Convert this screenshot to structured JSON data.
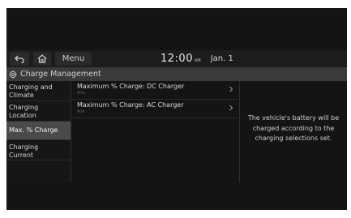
{
  "topbar": {
    "menu_label": "Menu",
    "time": "12:00",
    "ampm": "AM",
    "date": "Jan. 1"
  },
  "icons": {
    "back": "back-arrow-icon",
    "home": "home-icon",
    "title": "gear-icon",
    "chevron": "chevron-right-icon"
  },
  "title": "Charge Management",
  "sidebar": {
    "items": [
      {
        "line1": "Charging and",
        "line2": "Climate",
        "active": false
      },
      {
        "line1": "Charging",
        "line2": "Location",
        "active": false
      },
      {
        "line1": "Max. % Charge",
        "line2": "",
        "active": true
      },
      {
        "line1": "Charging",
        "line2": "Current",
        "active": false
      }
    ]
  },
  "list": [
    {
      "title": "Maximum % Charge: DC Charger",
      "value": "90%"
    },
    {
      "title": "Maximum % Charge: AC Charger",
      "value": "90%"
    }
  ],
  "info": {
    "line1": "The vehicle's battery will be",
    "line2": "charged according to the",
    "line3": "charging selections set."
  },
  "colors": {
    "screen_bg": "#141414",
    "title_bar": "#3a3a3a",
    "active_item": "#4a4a4a"
  }
}
